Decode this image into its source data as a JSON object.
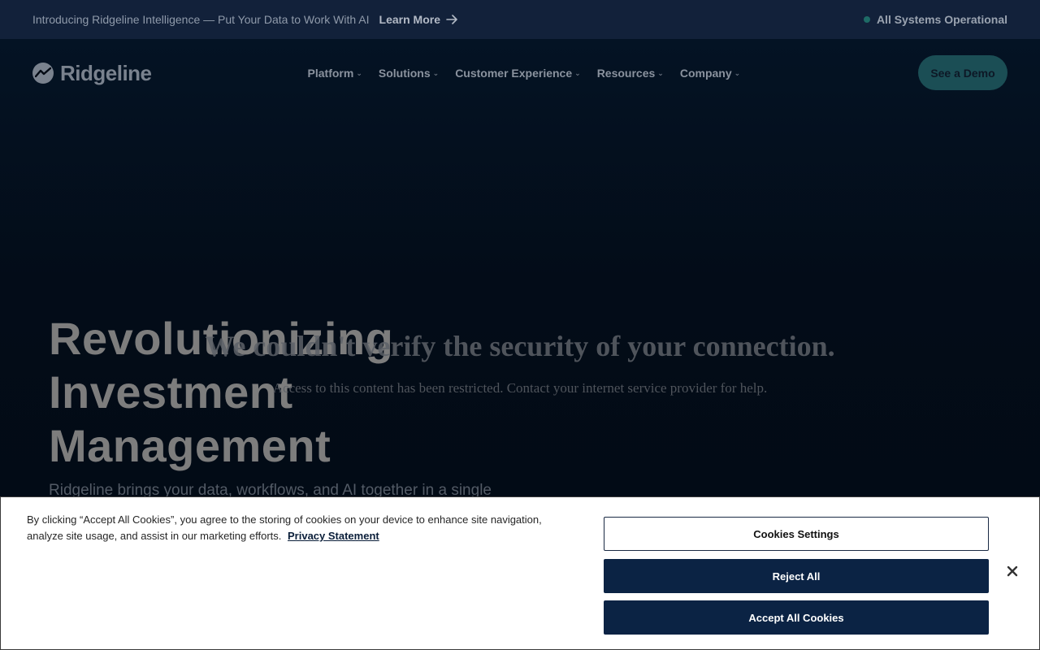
{
  "announcement": {
    "text": "Introducing Ridgeline Intelligence — Put Your Data to Work With AI",
    "link_label": "Learn More",
    "status_label": "All Systems Operational"
  },
  "nav": {
    "brand": "Ridgeline",
    "items": [
      {
        "label": "Platform"
      },
      {
        "label": "Solutions"
      },
      {
        "label": "Customer Experience"
      },
      {
        "label": "Resources"
      },
      {
        "label": "Company"
      }
    ],
    "demo_button": "See a Demo"
  },
  "hero": {
    "headline": [
      "Revolutionizing",
      "Investment",
      "Management"
    ],
    "subtext": "Ridgeline brings your data, workflows, and AI together in a single"
  },
  "block_notice": {
    "title": "We couldn't verify the security of your connection.",
    "message": "Access to this content has been restricted. Contact your internet service provider for help."
  },
  "cookie_banner": {
    "text": "By clicking “Accept All Cookies”, you agree to the storing of cookies on your device to enhance site navigation, analyze site usage, and assist in our marketing efforts.",
    "privacy_link": "Privacy Statement",
    "settings_button": "Cookies Settings",
    "reject_button": "Reject All",
    "accept_button": "Accept All Cookies"
  },
  "colors": {
    "announce_bg": "#12213a",
    "primary_button": "#0b2344",
    "demo_button": "#1b4e55",
    "status_dot": "#1e6b66"
  },
  "icons": {
    "learn_more": "arrow-right-icon",
    "status": "status-dot-icon",
    "brand": "ridgeline-logo-icon",
    "nav_dropdown": "chevron-down-icon",
    "close": "close-icon"
  }
}
